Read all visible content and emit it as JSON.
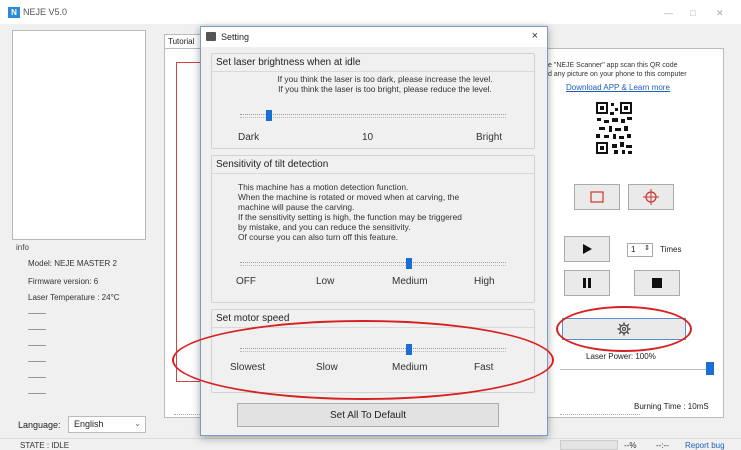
{
  "app": {
    "logo_text": "N",
    "title": "NEJE V5.0",
    "minimize": "—",
    "maximize": "□",
    "close": "✕"
  },
  "info": {
    "title": "info",
    "model": "Model: NEJE MASTER 2",
    "firmware": "Firmware version: 6",
    "temperature": "Laser Temperature : 24°C"
  },
  "language": {
    "label": "Language:",
    "value": "English"
  },
  "status": {
    "state": "STATE : IDLE",
    "percent": "--%",
    "time": "--:--",
    "report": "Report bug"
  },
  "tab": {
    "label": "Tutorial"
  },
  "qr_panel": {
    "line1": "e \"NEJE Scanner\" app scan this QR code",
    "line2": "d any picture on your phone to this computer",
    "link": "Download APP & Learn more"
  },
  "controls": {
    "times_value": "1",
    "times_label": "Times",
    "laser_power": "Laser Power: 100%",
    "laser_power_level": 1.0,
    "burning_time": "Burning Time : 10mS"
  },
  "dialog": {
    "title": "Setting",
    "close": "×",
    "brightness": {
      "title": "Set laser brightness when at idle",
      "desc1": "If you think the laser is too dark, please increase the level.",
      "desc2": "If you think the laser is too bright, please reduce the  level.",
      "min_label": "Dark",
      "value_label": "10",
      "max_label": "Bright"
    },
    "tilt": {
      "title": "Sensitivity of tilt detection",
      "desc": [
        "This machine has a motion detection function.",
        "When the machine is rotated or moved when at carving, the",
        "machine will pause the carving.",
        "If the sensitivity setting is high, the function may be triggered",
        "by mistake, and you can reduce the sensitivity.",
        "Of course you can also turn off this feature."
      ],
      "levels": [
        "OFF",
        "Low",
        "Medium",
        "High"
      ],
      "selected": "Medium"
    },
    "motor": {
      "title": "Set motor speed",
      "levels": [
        "Slowest",
        "Slow",
        "Medium",
        "Fast"
      ],
      "selected": "Medium"
    },
    "default_button": "Set All To Default"
  },
  "colors": {
    "accent": "#1a6fd6",
    "annotation": "#d82020",
    "link": "#1f5fb8"
  }
}
